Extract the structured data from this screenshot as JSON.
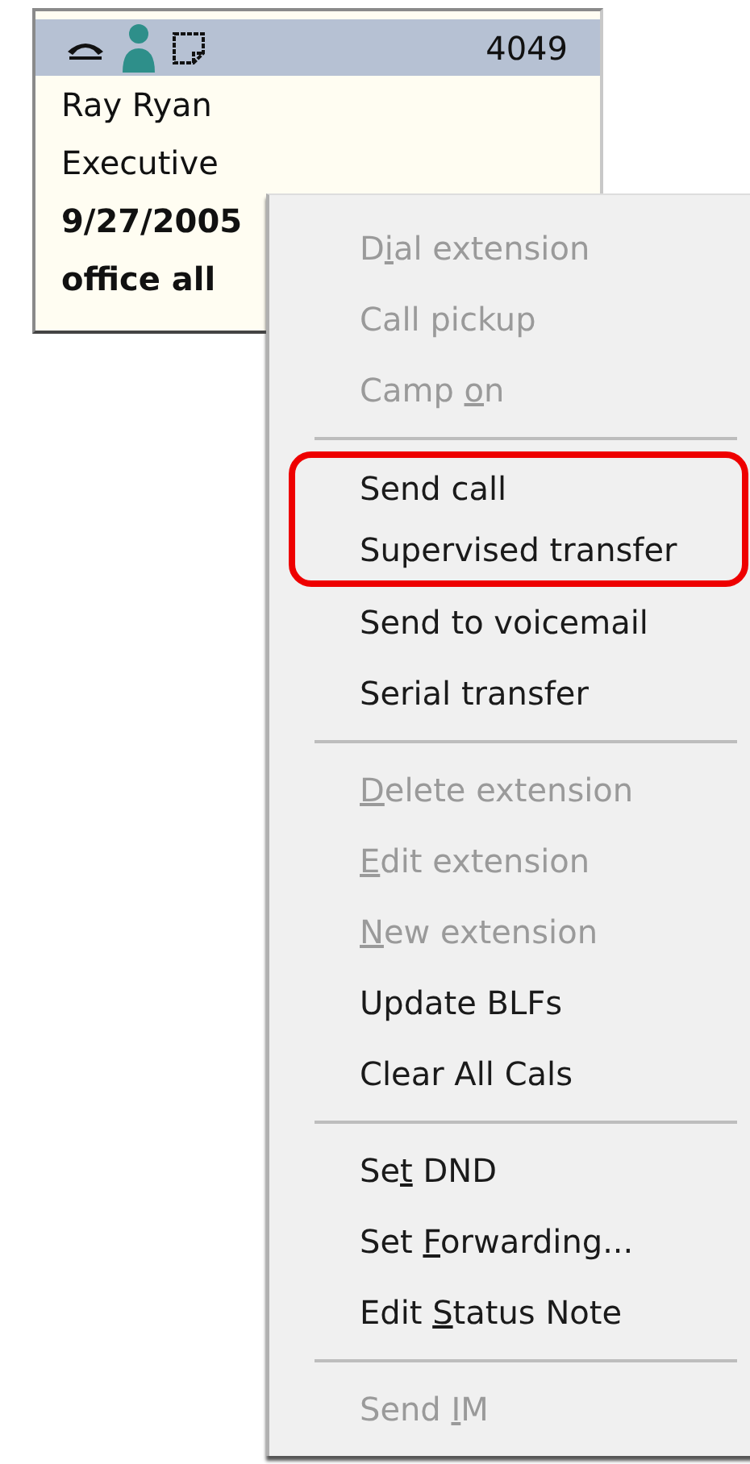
{
  "card": {
    "extension": "4049",
    "lines": [
      {
        "text": "Ray Ryan",
        "bold": false
      },
      {
        "text": "Executive",
        "bold": false
      },
      {
        "text": "9/27/2005",
        "bold": true
      },
      {
        "text": "office all",
        "bold": true
      }
    ]
  },
  "menu": {
    "sections": [
      {
        "items": [
          {
            "pre": "D",
            "key": "i",
            "post": "al extension",
            "disabled": true,
            "highlighted": false
          },
          {
            "label": "Call pickup",
            "disabled": true,
            "highlighted": false
          },
          {
            "pre": "Camp ",
            "key": "o",
            "post": "n",
            "disabled": true,
            "highlighted": false
          }
        ]
      },
      {
        "items": [
          {
            "label": "Send call",
            "disabled": false,
            "highlighted": true
          },
          {
            "label": "Supervised transfer",
            "disabled": false,
            "highlighted": true
          },
          {
            "label": "Send to voicemail",
            "disabled": false,
            "highlighted": false
          },
          {
            "label": "Serial transfer",
            "disabled": false,
            "highlighted": false
          }
        ]
      },
      {
        "items": [
          {
            "key": "D",
            "post": "elete extension",
            "disabled": true,
            "highlighted": false
          },
          {
            "key": "E",
            "post": "dit extension",
            "disabled": true,
            "highlighted": false
          },
          {
            "key": "N",
            "post": "ew extension",
            "disabled": true,
            "highlighted": false
          },
          {
            "label": "Update BLFs",
            "disabled": false,
            "highlighted": false
          },
          {
            "label": "Clear All Cals",
            "disabled": false,
            "highlighted": false
          }
        ]
      },
      {
        "items": [
          {
            "pre": "Se",
            "key": "t",
            "post": " DND",
            "disabled": false,
            "highlighted": false
          },
          {
            "pre": "Set ",
            "key": "F",
            "post": "orwarding...",
            "disabled": false,
            "highlighted": false
          },
          {
            "pre": "Edit ",
            "key": "S",
            "post": "tatus Note",
            "disabled": false,
            "highlighted": false
          }
        ]
      },
      {
        "items": [
          {
            "pre": "Send ",
            "key": "I",
            "post": "M",
            "disabled": true,
            "highlighted": false
          }
        ]
      }
    ]
  }
}
